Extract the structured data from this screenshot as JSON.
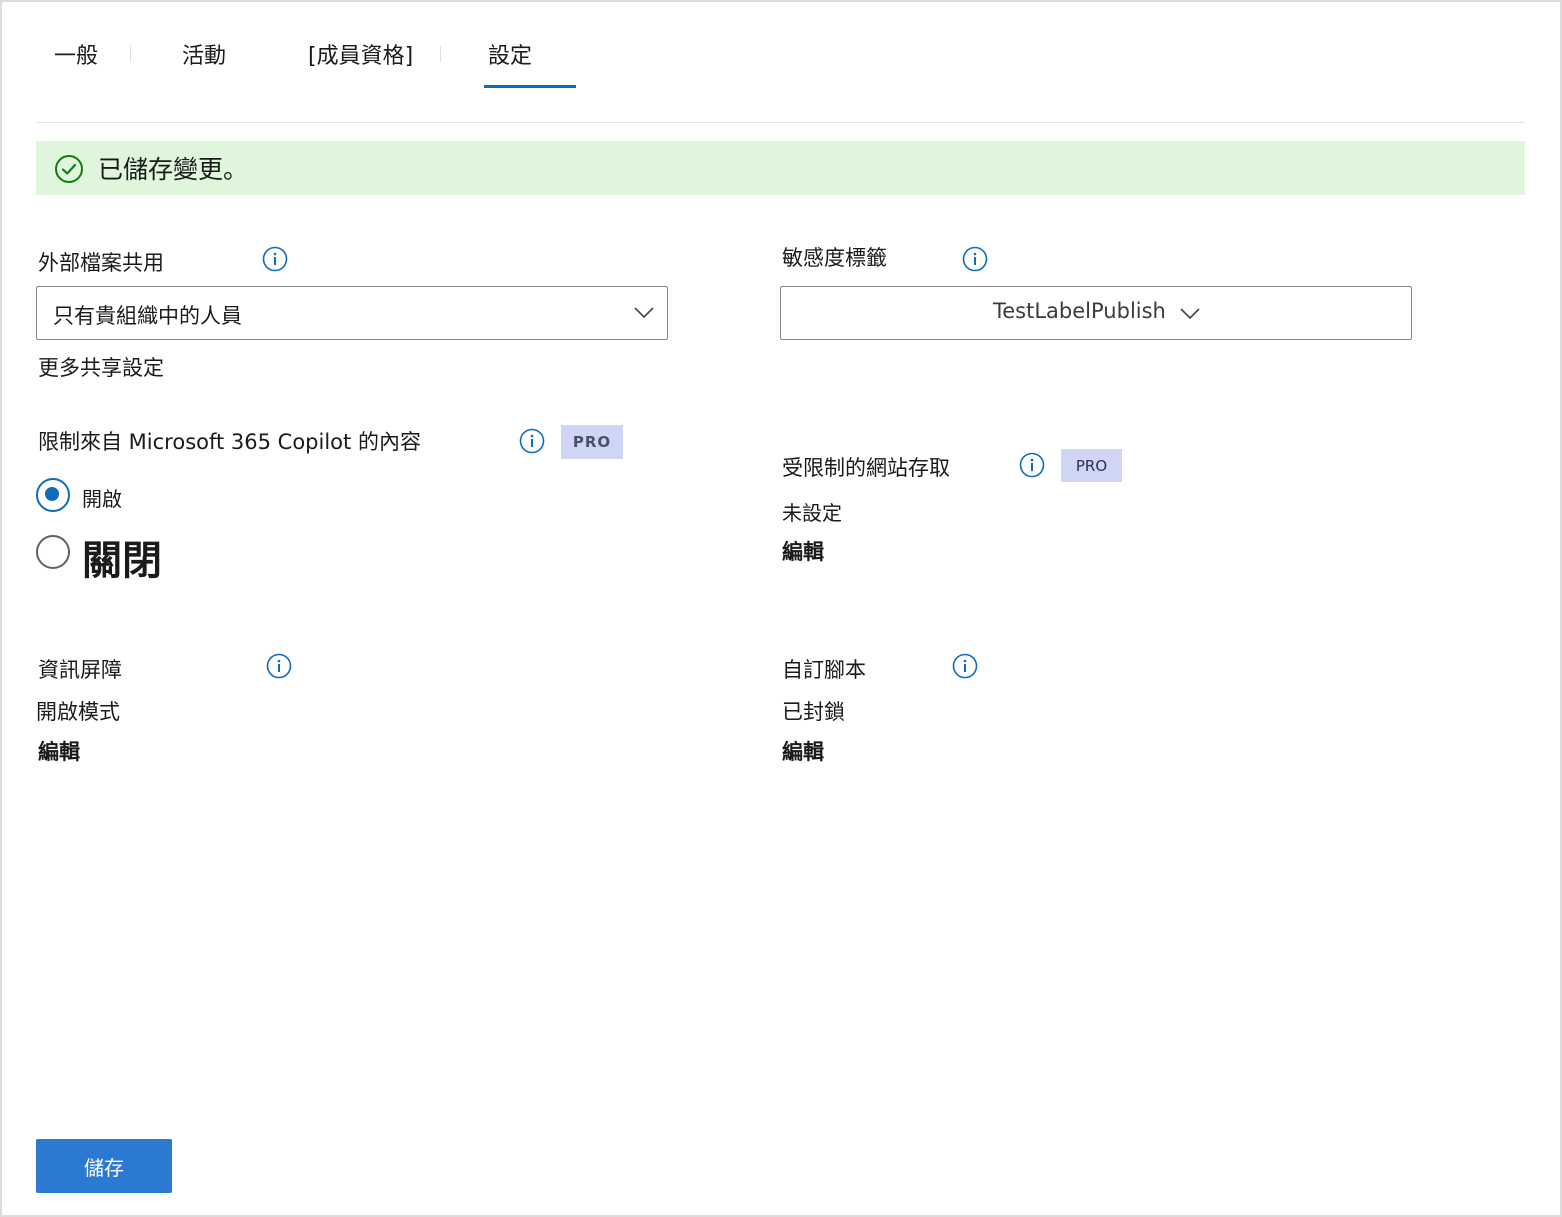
{
  "tabs": [
    {
      "label": "一般"
    },
    {
      "label": "活動"
    },
    {
      "label": "[成員資格]"
    },
    {
      "label": "設定"
    }
  ],
  "banner": {
    "message": "已儲存變更。",
    "color": "#dff6dd"
  },
  "external_sharing": {
    "label": "外部檔案共用",
    "selected": "只有貴組織中的人員",
    "more_settings_link": "更多共享設定"
  },
  "sensitivity": {
    "label": "敏感度標籤",
    "selected": "TestLabelPublish"
  },
  "copilot": {
    "label": "限制來自 Microsoft 365 Copilot 的內容",
    "badge": "PRO",
    "options": [
      {
        "label": "開啟",
        "selected": true
      },
      {
        "label": "關閉",
        "selected": false
      }
    ]
  },
  "restricted_access": {
    "label": "受限制的網站存取",
    "badge": "PRO",
    "value": "未設定",
    "edit": "編輯"
  },
  "info_barrier": {
    "label": "資訊屏障",
    "value": "開啟模式",
    "edit": "編輯"
  },
  "custom_script": {
    "label": "自訂腳本",
    "value": "已封鎖",
    "edit": "編輯"
  },
  "footer": {
    "save_label": "儲存"
  },
  "colors": {
    "accent": "#0f6cbd",
    "button": "#2b79d1",
    "badge": "#cfd5f4"
  }
}
